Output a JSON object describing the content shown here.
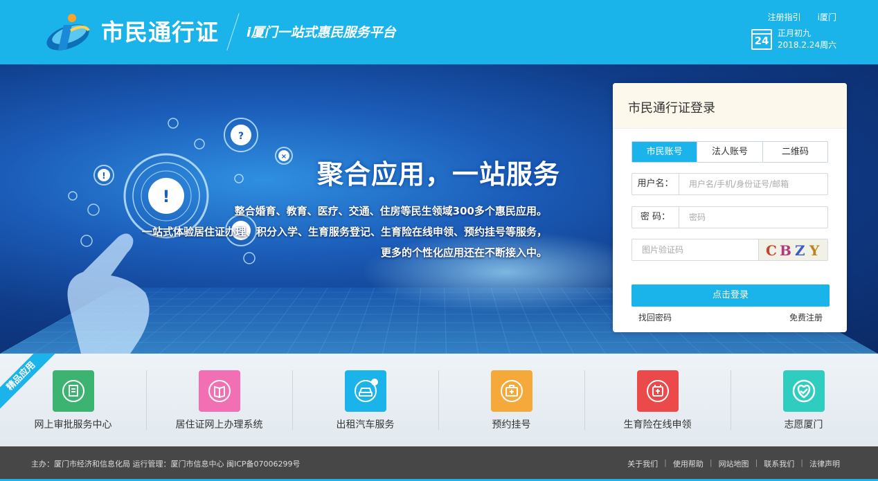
{
  "header": {
    "site_name": "市民通行证",
    "slogan": "i厦门一站式惠民服务平台",
    "links": [
      "注册指引",
      "i厦门"
    ],
    "date": {
      "day": "24",
      "lunar": "正月初九",
      "solar": "2018.2.24周六"
    },
    "brand_color": "#1ab4ea"
  },
  "banner": {
    "title": "聚合应用，一站服务",
    "lines": [
      "整合婚育、教育、医疗、交通、住房等民生领域300多个惠民应用。",
      "一站式体验居住证办理、积分入学、生育服务登记、生育险在线申领、预约挂号等服务，",
      "更多的个性化应用还在不断接入中。"
    ]
  },
  "login": {
    "title": "市民通行证登录",
    "tabs": [
      {
        "label": "市民账号",
        "active": true
      },
      {
        "label": "法人账号",
        "active": false
      },
      {
        "label": "二维码",
        "active": false
      }
    ],
    "username_label": "用户名：",
    "username_placeholder": "用户名/手机/身份证号/邮箱",
    "password_label": "密 码：",
    "password_placeholder": "密码",
    "captcha_placeholder": "图片验证码",
    "captcha_chars": [
      "C",
      "B",
      "Z",
      "Y"
    ],
    "submit_label": "点击登录",
    "forgot_label": "找回密码",
    "register_label": "免费注册"
  },
  "apps": {
    "ribbon_label": "精品应用",
    "items": [
      {
        "label": "网上审批服务中心",
        "icon": "document-stamp-icon",
        "color": "#3cb371"
      },
      {
        "label": "居住证网上办理系统",
        "icon": "id-book-icon",
        "color": "#f36fb4"
      },
      {
        "label": "出租汽车服务",
        "icon": "taxi-icon",
        "color": "#1ab4ea"
      },
      {
        "label": "预约挂号",
        "icon": "medical-kit-icon",
        "color": "#f6a93b"
      },
      {
        "label": "生育险在线申领",
        "icon": "insurance-badge-icon",
        "color": "#ec4a4a"
      },
      {
        "label": "志愿厦门",
        "icon": "heart-check-icon",
        "color": "#2ecdc0"
      }
    ]
  },
  "footer": {
    "left": "主办：厦门市经济和信息化局  运行管理：厦门市信息中心  闽ICP备07006299号",
    "links": [
      "关于我们",
      "使用帮助",
      "网站地图",
      "联系我们",
      "法律声明"
    ]
  }
}
